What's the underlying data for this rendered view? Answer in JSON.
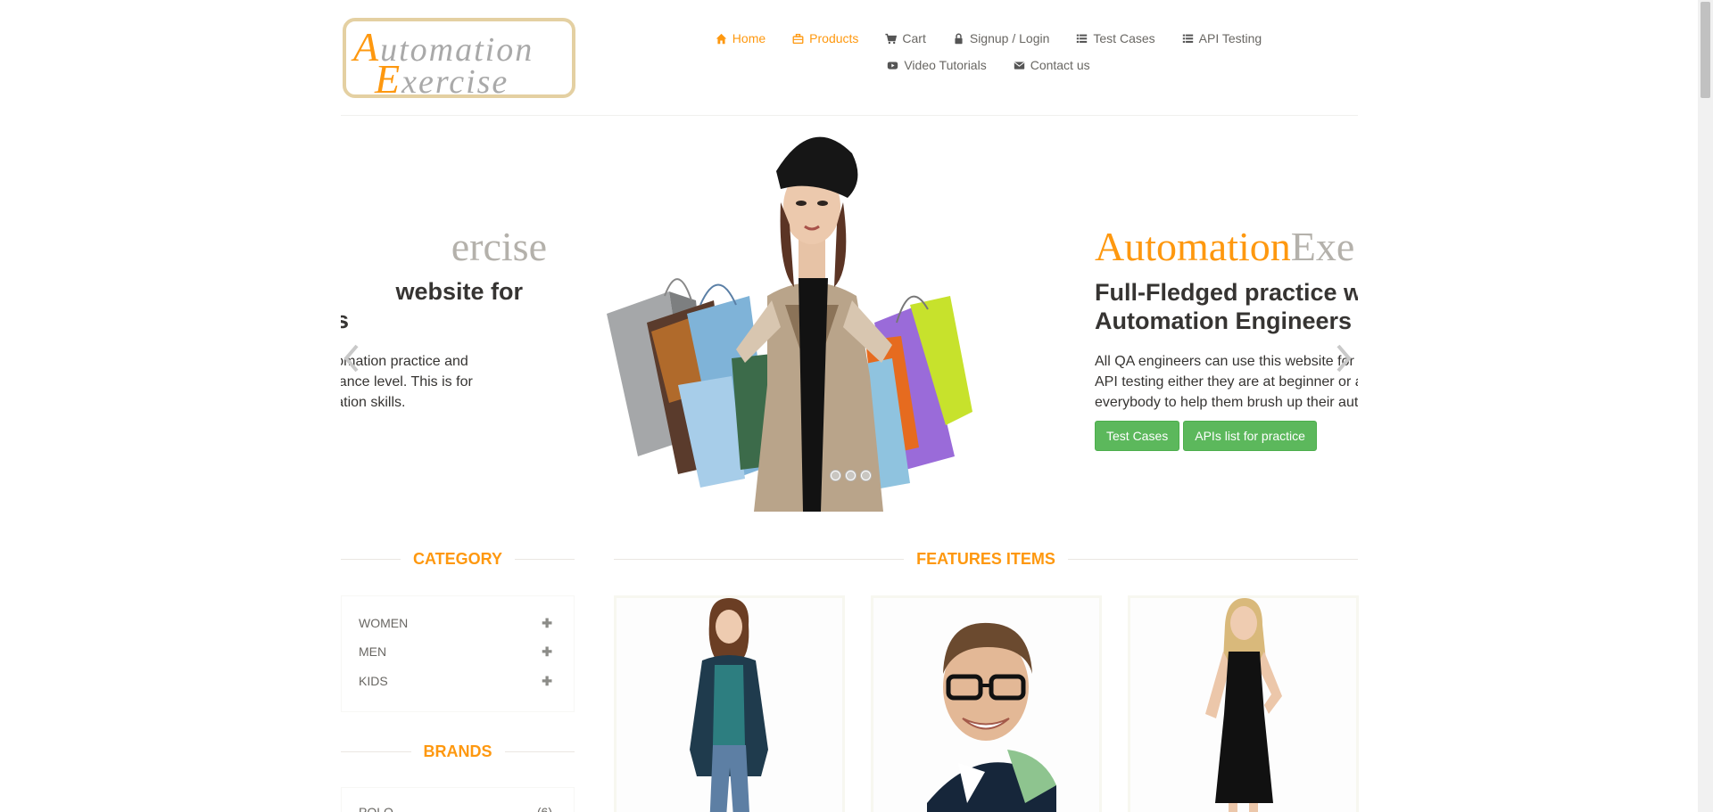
{
  "logo": {
    "line1_cap": "A",
    "line1_rest": "utomation",
    "line2_cap": "E",
    "line2_rest": "xercise"
  },
  "nav": {
    "row1": [
      {
        "label": "Home",
        "icon": "home-icon",
        "active": true
      },
      {
        "label": "Products",
        "icon": "products-icon",
        "active": true
      },
      {
        "label": "Cart",
        "icon": "cart-icon"
      },
      {
        "label": "Signup / Login",
        "icon": "lock-icon"
      },
      {
        "label": "Test Cases",
        "icon": "list-icon"
      },
      {
        "label": "API Testing",
        "icon": "list-icon"
      }
    ],
    "row2": [
      {
        "label": "Video Tutorials",
        "icon": "youtube-icon"
      },
      {
        "label": "Contact us",
        "icon": "envelope-icon"
      }
    ]
  },
  "slider": {
    "prev_slide": {
      "brand": "ercise",
      "heading_line1": "website for",
      "heading_line2": "s",
      "text_lines": [
        "automation practice and",
        "advance level. This is for",
        "omation skills."
      ]
    },
    "current_slide": {
      "brand_orange": "Automation",
      "brand_gray": "Exe",
      "heading_line1": "Full-Fledged practice w",
      "heading_line2": "Automation Engineers",
      "text_lines": [
        "All QA engineers can use this website for",
        "API testing either they are at beginner or a",
        "everybody to help them brush up their aut"
      ],
      "btn_test_cases": "Test Cases",
      "btn_apis": "APIs list for practice"
    },
    "indicator_count": 3
  },
  "sidebar": {
    "category_title": "CATEGORY",
    "categories": [
      "WOMEN",
      "MEN",
      "KIDS"
    ],
    "brands_title": "BRANDS",
    "first_brand": "POLO",
    "first_brand_count": "(6)"
  },
  "main": {
    "features_title": "FEATURES ITEMS"
  },
  "colors": {
    "accent": "#fe980f",
    "button_green": "#5cb85c",
    "text": "#696763"
  }
}
